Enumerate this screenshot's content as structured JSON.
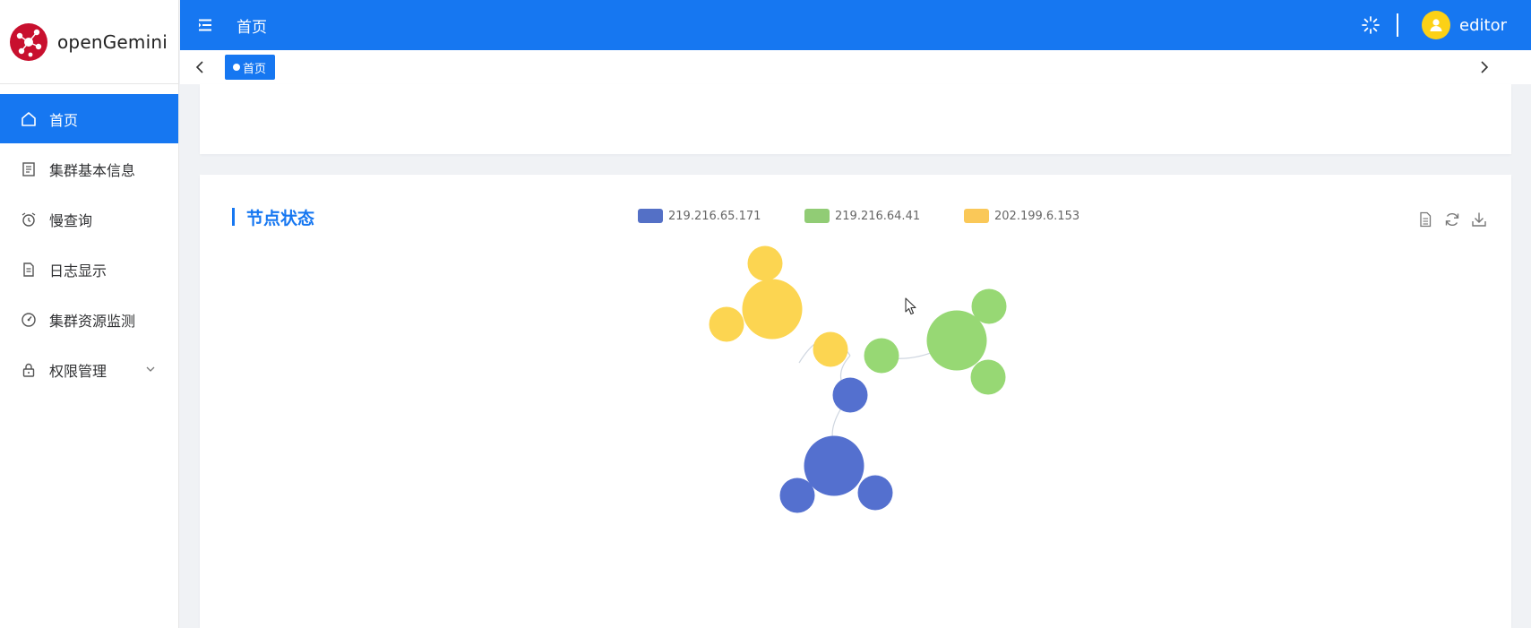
{
  "app": {
    "name": "openGemini",
    "brand_color": "#1677f1",
    "logo_color": "#c8102e"
  },
  "header": {
    "title": "首页",
    "username": "editor",
    "avatar_color": "#fcd116"
  },
  "tags": {
    "active_label": "首页"
  },
  "sidebar": {
    "items": [
      {
        "label": "首页",
        "icon": "home-icon",
        "active": true
      },
      {
        "label": "集群基本信息",
        "icon": "document-icon",
        "active": false
      },
      {
        "label": "慢查询",
        "icon": "alarm-clock-icon",
        "active": false
      },
      {
        "label": "日志显示",
        "icon": "file-text-icon",
        "active": false
      },
      {
        "label": "集群资源监测",
        "icon": "gauge-icon",
        "active": false
      },
      {
        "label": "权限管理",
        "icon": "lock-icon",
        "active": false,
        "expandable": true
      }
    ]
  },
  "node_card": {
    "title": "节点状态",
    "tools": [
      "data-view-icon",
      "refresh-icon",
      "download-icon"
    ]
  },
  "chart_data": {
    "type": "graph",
    "title": "节点状态",
    "legend_position": "top-center",
    "series": [
      {
        "name": "219.216.65.171",
        "color": "#5470c6",
        "nodes": 4
      },
      {
        "name": "219.216.64.41",
        "color": "#91cc75",
        "nodes": 4
      },
      {
        "name": "202.199.6.153",
        "color": "#fac858",
        "nodes": 4
      }
    ]
  }
}
